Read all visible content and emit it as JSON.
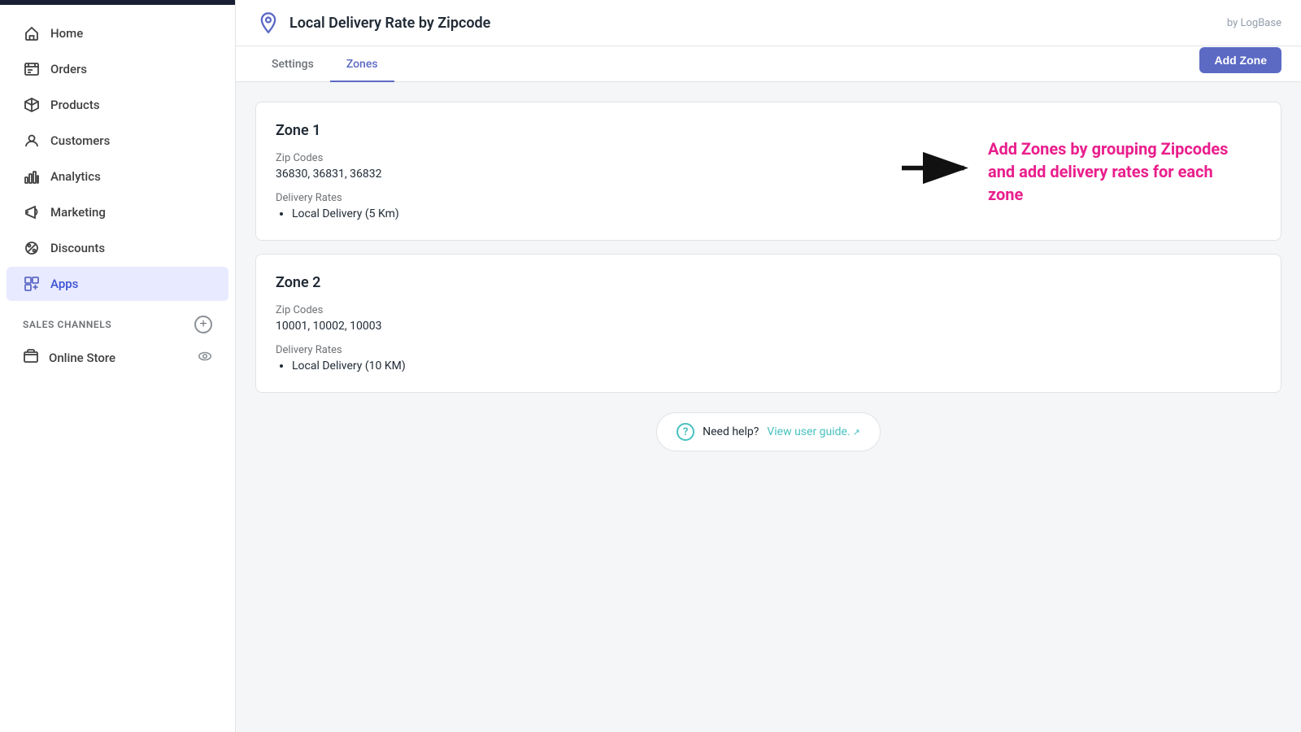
{
  "sidebar": {
    "nav_items": [
      {
        "id": "home",
        "label": "Home",
        "icon": "home-icon"
      },
      {
        "id": "orders",
        "label": "Orders",
        "icon": "orders-icon"
      },
      {
        "id": "products",
        "label": "Products",
        "icon": "products-icon"
      },
      {
        "id": "customers",
        "label": "Customers",
        "icon": "customers-icon"
      },
      {
        "id": "analytics",
        "label": "Analytics",
        "icon": "analytics-icon"
      },
      {
        "id": "marketing",
        "label": "Marketing",
        "icon": "marketing-icon"
      },
      {
        "id": "discounts",
        "label": "Discounts",
        "icon": "discounts-icon"
      },
      {
        "id": "apps",
        "label": "Apps",
        "icon": "apps-icon"
      }
    ],
    "sales_channels_label": "SALES CHANNELS",
    "online_store_label": "Online Store"
  },
  "header": {
    "app_icon": "location-icon",
    "app_title": "Local Delivery Rate by Zipcode",
    "by_logbase": "by LogBase"
  },
  "tabs": [
    {
      "id": "settings",
      "label": "Settings",
      "active": false
    },
    {
      "id": "zones",
      "label": "Zones",
      "active": true
    }
  ],
  "add_zone_button": "Add Zone",
  "zones": [
    {
      "id": "zone1",
      "name": "Zone 1",
      "zip_codes_label": "Zip Codes",
      "zip_codes": "36830, 36831, 36832",
      "delivery_rates_label": "Delivery Rates",
      "delivery_rates": [
        "Local Delivery (5 Km)"
      ]
    },
    {
      "id": "zone2",
      "name": "Zone 2",
      "zip_codes_label": "Zip Codes",
      "zip_codes": "10001, 10002, 10003",
      "delivery_rates_label": "Delivery Rates",
      "delivery_rates": [
        "Local Delivery (10 KM)"
      ]
    }
  ],
  "annotation": {
    "text": "Add Zones by grouping Zipcodes and add delivery rates for each zone"
  },
  "help": {
    "text": "Need help?",
    "link_label": "View user guide.",
    "link_icon": "external-link-icon"
  }
}
